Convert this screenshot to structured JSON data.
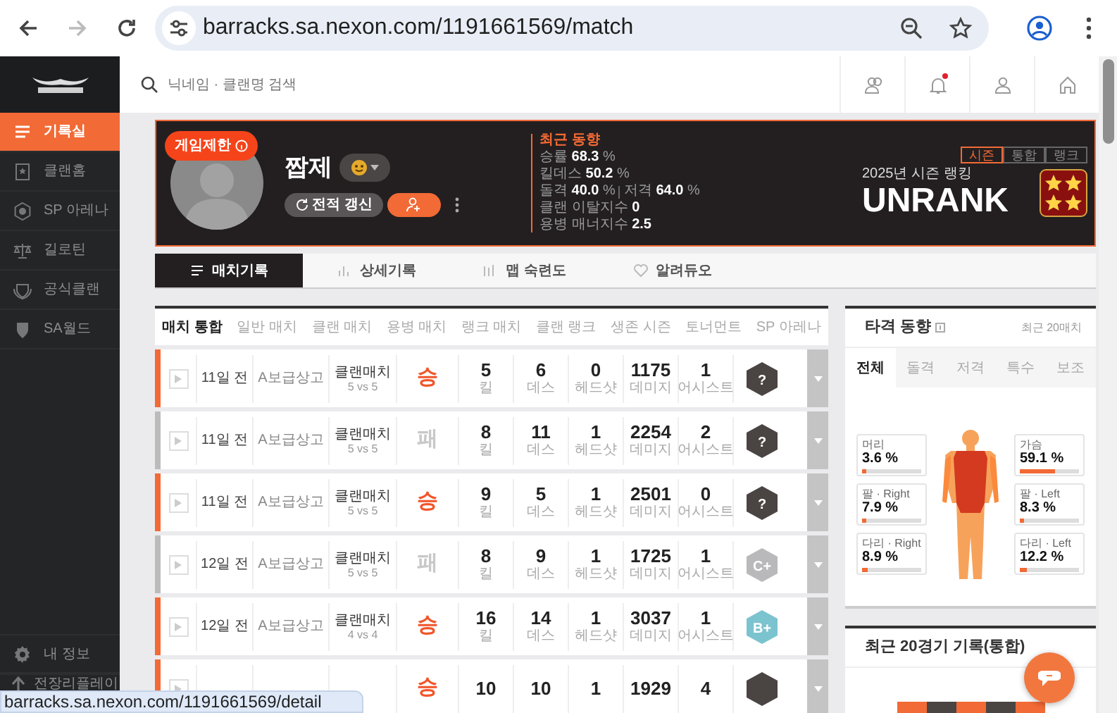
{
  "browser": {
    "url": "barracks.sa.nexon.com/1191661569/match",
    "status_url": "barracks.sa.nexon.com/1191661569/detail",
    "forward_disabled": true
  },
  "sidebar": {
    "items": [
      {
        "label": "기록실",
        "selected": true
      },
      {
        "label": "클랜홈",
        "selected": false
      },
      {
        "label": "SP 아레나",
        "selected": false
      },
      {
        "label": "길로틴",
        "selected": false
      },
      {
        "label": "공식클랜",
        "selected": false
      },
      {
        "label": "SA월드",
        "selected": false
      }
    ],
    "bottom_items": [
      {
        "label": "내 정보"
      },
      {
        "label": "전장리플레이"
      }
    ]
  },
  "search": {
    "placeholder": "닉네임 · 클랜명 검색"
  },
  "notifications": {
    "unread": true
  },
  "profile": {
    "restriction_badge": "게임제한",
    "name": "짭제",
    "refresh_button": "전적 갱신",
    "recent_title": "최근 동향",
    "stats": [
      {
        "label": "승률",
        "value": "68.3",
        "unit": "%"
      },
      {
        "label": "킬데스",
        "value": "50.2",
        "unit": "%"
      }
    ],
    "weapon_stats": [
      {
        "label": "돌격",
        "value": "40.0",
        "unit": "%"
      },
      {
        "label": "저격",
        "value": "64.0",
        "unit": "%"
      }
    ],
    "indices": [
      {
        "label": "클랜 이탈지수",
        "value": "0"
      },
      {
        "label": "용병 매너지수",
        "value": "2.5"
      }
    ],
    "rank_toggle": [
      {
        "label": "시즌",
        "selected": true
      },
      {
        "label": "통합",
        "selected": false
      },
      {
        "label": "랭크",
        "selected": false
      }
    ],
    "season_label": "2025년 시즌 랭킹",
    "rank": "UNRANK"
  },
  "tabs": [
    {
      "label": "매치기록",
      "selected": true
    },
    {
      "label": "상세기록",
      "selected": false
    },
    {
      "label": "맵 숙련도",
      "selected": false
    },
    {
      "label": "알려듀오",
      "selected": false
    }
  ],
  "filters": [
    {
      "label": "매치 통합",
      "selected": true
    },
    {
      "label": "일반 매치",
      "selected": false
    },
    {
      "label": "클랜 매치",
      "selected": false
    },
    {
      "label": "용병 매치",
      "selected": false
    },
    {
      "label": "랭크 매치",
      "selected": false
    },
    {
      "label": "클랜 랭크",
      "selected": false
    },
    {
      "label": "생존 시즌",
      "selected": false
    },
    {
      "label": "토너먼트",
      "selected": false
    },
    {
      "label": "SP 아레나",
      "selected": false
    }
  ],
  "matches": [
    {
      "date": "11일 전",
      "map": "A보급상고",
      "mode": "클랜매치",
      "team_size": "5 vs 5",
      "result": "승",
      "win": true,
      "stats": [
        {
          "value": "5",
          "label": "킬"
        },
        {
          "value": "6",
          "label": "데스"
        },
        {
          "value": "0",
          "label": "헤드샷"
        },
        {
          "value": "1175",
          "label": "데미지"
        },
        {
          "value": "1",
          "label": "어시스트"
        }
      ],
      "grade": "?",
      "color": "#4a4443"
    },
    {
      "date": "11일 전",
      "map": "A보급상고",
      "mode": "클랜매치",
      "team_size": "5 vs 5",
      "result": "패",
      "win": false,
      "stats": [
        {
          "value": "8",
          "label": "킬"
        },
        {
          "value": "11",
          "label": "데스"
        },
        {
          "value": "1",
          "label": "헤드샷"
        },
        {
          "value": "2254",
          "label": "데미지"
        },
        {
          "value": "2",
          "label": "어시스트"
        }
      ],
      "grade": "?",
      "color": "#4a4443"
    },
    {
      "date": "11일 전",
      "map": "A보급상고",
      "mode": "클랜매치",
      "team_size": "5 vs 5",
      "result": "승",
      "win": true,
      "stats": [
        {
          "value": "9",
          "label": "킬"
        },
        {
          "value": "5",
          "label": "데스"
        },
        {
          "value": "1",
          "label": "헤드샷"
        },
        {
          "value": "2501",
          "label": "데미지"
        },
        {
          "value": "0",
          "label": "어시스트"
        }
      ],
      "grade": "?",
      "color": "#4a4443"
    },
    {
      "date": "12일 전",
      "map": "A보급상고",
      "mode": "클랜매치",
      "team_size": "5 vs 5",
      "result": "패",
      "win": false,
      "stats": [
        {
          "value": "8",
          "label": "킬"
        },
        {
          "value": "9",
          "label": "데스"
        },
        {
          "value": "1",
          "label": "헤드샷"
        },
        {
          "value": "1725",
          "label": "데미지"
        },
        {
          "value": "1",
          "label": "어시스트"
        }
      ],
      "grade": "C+",
      "color": "#b9b9bb"
    },
    {
      "date": "12일 전",
      "map": "A보급상고",
      "mode": "클랜매치",
      "team_size": "4 vs 4",
      "result": "승",
      "win": true,
      "stats": [
        {
          "value": "16",
          "label": "킬"
        },
        {
          "value": "14",
          "label": "데스"
        },
        {
          "value": "1",
          "label": "헤드샷"
        },
        {
          "value": "3037",
          "label": "데미지"
        },
        {
          "value": "1",
          "label": "어시스트"
        }
      ],
      "grade": "B+",
      "color": "#7cc3d0"
    },
    {
      "result": "승",
      "win": true,
      "stats": [
        {
          "value": "10"
        },
        {
          "value": "10"
        },
        {
          "value": "1"
        },
        {
          "value": "1929"
        },
        {
          "value": "4"
        }
      ],
      "color": "#4a4443"
    }
  ],
  "hit_trend": {
    "title": "타격 동향",
    "period": "최근 20매치",
    "tabs": [
      {
        "label": "전체",
        "selected": true
      },
      {
        "label": "돌격",
        "selected": false
      },
      {
        "label": "저격",
        "selected": false
      },
      {
        "label": "특수",
        "selected": false
      },
      {
        "label": "보조",
        "selected": false
      }
    ],
    "parts_left": [
      {
        "label": "머리",
        "value": "3.6",
        "unit": "%",
        "level": 0.036
      },
      {
        "label": "팔 · Right",
        "value": "7.9",
        "unit": "%",
        "level": 0.079
      },
      {
        "label": "다리 · Right",
        "value": "8.9",
        "unit": "%",
        "level": 0.089
      }
    ],
    "parts_right": [
      {
        "label": "가슴",
        "value": "59.1",
        "unit": "%",
        "level": 0.591
      },
      {
        "label": "팔 · Left",
        "value": "8.3",
        "unit": "%",
        "level": 0.083
      },
      {
        "label": "다리 · Left",
        "value": "12.2",
        "unit": "%",
        "level": 0.122
      }
    ]
  },
  "recent_record": {
    "title": "최근 20경기 기록(통합)",
    "results": [
      {
        "win": true
      },
      {
        "win": false
      },
      {
        "win": true
      },
      {
        "win": false
      },
      {
        "win": true
      }
    ]
  }
}
